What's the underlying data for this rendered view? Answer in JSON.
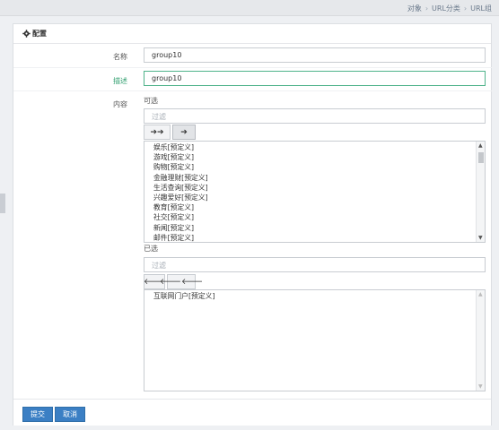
{
  "breadcrumb": [
    "对象",
    "URL分类",
    "URL组"
  ],
  "panel": {
    "title": "配置"
  },
  "form": {
    "name_label": "名称",
    "name_value": "group10",
    "desc_label": "描述",
    "desc_value": "group10",
    "content_label": "内容"
  },
  "available": {
    "label": "可选",
    "filter_placeholder": "过滤",
    "move_all_label": "➔➔",
    "move_one_label": "➔",
    "items": [
      "娱乐[预定义]",
      "游戏[预定义]",
      "购物[预定义]",
      "金融理财[预定义]",
      "生活查询[预定义]",
      "兴趣爱好[预定义]",
      "教育[预定义]",
      "社交[预定义]",
      "新闻[预定义]",
      "邮件[预定义]"
    ]
  },
  "selected": {
    "label": "已选",
    "filter_placeholder": "过滤",
    "remove_one_label": "🡐",
    "remove_all_label": "🡐🡐",
    "items": [
      "互联网门户[预定义]"
    ]
  },
  "actions": {
    "submit": "提交",
    "cancel": "取消"
  },
  "colors": {
    "primary": "#3b7fc4",
    "focus_border": "#4fb38a",
    "active_label": "#2f9e6e"
  }
}
